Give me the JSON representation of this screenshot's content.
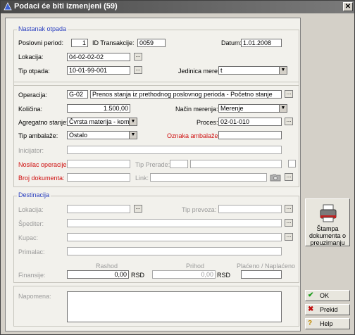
{
  "window": {
    "title": "Podaci će biti izmenjeni  (59)",
    "close": "✕"
  },
  "nastanak": {
    "title": "Nastanak otpada",
    "poslovni_period_label": "Poslovni period:",
    "poslovni_period": "1",
    "id_trans_label": "ID Transakcije:",
    "id_trans": "0059",
    "datum_label": "Datum:",
    "datum": "1.01.2008",
    "lokacija_label": "Lokacija:",
    "lokacija": "04-02-02-02",
    "tip_otpada_label": "Tip otpada:",
    "tip_otpada": "10-01-99-001",
    "jedinica_label": "Jedinica mere:",
    "jedinica": "t"
  },
  "operacija": {
    "operacija_label": "Operacija:",
    "operacija_code": "G-02",
    "operacija_desc": "Prenos stanja iz prethodnog poslovnog perioda - Početno stanje",
    "kolicina_label": "Količina:",
    "kolicina": "1.500,00",
    "nacin_label": "Način merenja:",
    "nacin": "Merenje",
    "agregatno_label": "Agregatno stanje:",
    "agregatno": "Čvrsta materija - komad",
    "proces_label": "Proces:",
    "proces": "02-01-010",
    "tip_ambalaze_label": "Tip ambalaže:",
    "tip_ambalaze": "Ostalo",
    "oznaka_label": "Oznaka ambalaže:",
    "oznaka": "",
    "inicijator_label": "Inicijator:",
    "nosilac_label": "Nosilac operacije:",
    "tip_prerade_label": "Tip Prerade:",
    "broj_label": "Broj dokumenta:",
    "link_label": "Link:"
  },
  "destinacija": {
    "title": "Destinacija",
    "lokacija_label": "Lokacija:",
    "tip_prevoza_label": "Tip prevoza:",
    "spediter_label": "Špediter:",
    "kupac_label": "Kupac:",
    "primalac_label": "Primalac:",
    "finansije_label": "Finansije:",
    "rashod_label": "Rashod",
    "rashod": "0,00",
    "rashod_cur": "RSD",
    "prihod_label": "Prihod",
    "prihod": "0,00",
    "prihod_cur": "RSD",
    "placeno_label": "Plaćeno / Naplaćeno"
  },
  "napomena_label": "Napomena:",
  "buttons": {
    "stampa": "Štampa dokumenta o preuzimanju",
    "ok": "OK",
    "prekid": "Prekid",
    "help": "Help"
  }
}
